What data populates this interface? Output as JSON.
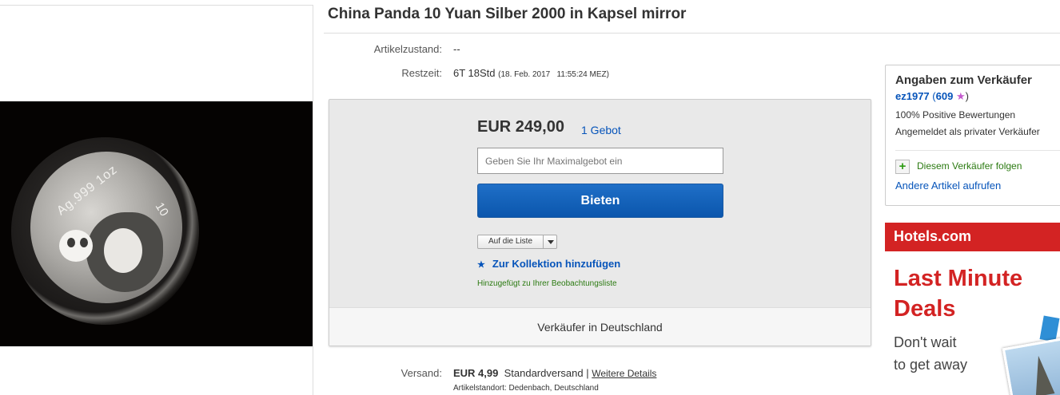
{
  "item": {
    "title": "China Panda 10 Yuan Silber 2000 in Kapsel mirror",
    "coin_inscription": "Ag.999 1oz",
    "coin_value_mark": "10"
  },
  "details": {
    "condition_label": "Artikelzustand:",
    "condition_value": "--",
    "timeleft_label": "Restzeit:",
    "timeleft_value": "6T 18Std",
    "timeleft_end": "(18. Feb. 2017   11:55:24 MEZ)"
  },
  "bid": {
    "price": "EUR 249,00",
    "bid_count": "1 Gebot",
    "max_bid_placeholder": "Geben Sie Ihr Maximalgebot ein",
    "bid_button": "Bieten",
    "watch_button": "Auf die Liste",
    "collection_link": "Zur Kollektion hinzufügen",
    "watch_notice": "Hinzugefügt zu Ihrer Beobachtungsliste",
    "seller_location": "Verkäufer in Deutschland"
  },
  "shipping": {
    "label": "Versand:",
    "price": "EUR 4,99",
    "method": "Standardversand |",
    "details_link": "Weitere Details",
    "location_label": "Artikelstandort:",
    "location_value": "Dedenbach, Deutschland"
  },
  "seller": {
    "heading": "Angaben zum Verkäufer",
    "username": "ez1977",
    "feedback_open": "(",
    "feedback_score": "609",
    "feedback_close": ")",
    "positive": "100% Positive Bewertungen",
    "account_type": "Angemeldet als privater Verkäufer",
    "follow": "Diesem Verkäufer folgen",
    "other_items": "Andere Artikel aufrufen"
  },
  "ad": {
    "brand": "Hotels.com",
    "headline_1": "Last Minute",
    "headline_2": "Deals",
    "sub_1": "Don't wait",
    "sub_2": "to get away"
  },
  "colors": {
    "link": "#0654ba",
    "bid_button": "#0b56ad",
    "success": "#2b7a11",
    "ad_red": "#d32323",
    "feedback_star": "#c45bce"
  }
}
